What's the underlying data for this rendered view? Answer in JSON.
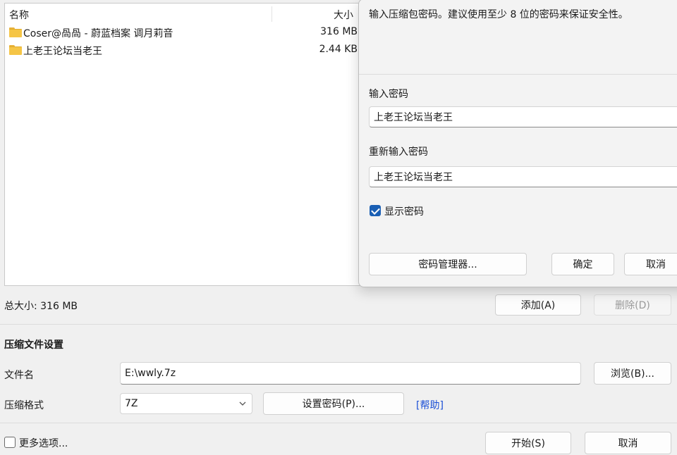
{
  "file_list": {
    "columns": {
      "name": "名称",
      "size": "大小"
    },
    "rows": [
      {
        "name": "Coser@咼咼 - 蔚蓝档案 调月莉音",
        "size": "316 MB",
        "icon": "folder-icon"
      },
      {
        "name": "上老王论坛当老王",
        "size": "2.44 KB",
        "icon": "folder-icon"
      }
    ]
  },
  "total_size": "总大小: 316 MB",
  "buttons": {
    "add": "添加(A)",
    "remove": "删除(D)",
    "browse": "浏览(B)...",
    "set_password": "设置密码(P)...",
    "start": "开始(S)",
    "cancel": "取消"
  },
  "settings": {
    "section_title": "压缩文件设置",
    "filename_label": "文件名",
    "filename_value": "E:\\wwly.7z",
    "format_label": "压缩格式",
    "format_value": "7Z",
    "help_link": "[帮助]",
    "more_options": "更多选项..."
  },
  "dialog": {
    "instruction": "输入压缩包密码。建议使用至少 8 位的密码来保证安全性。",
    "password_label": "输入密码",
    "password_value": "上老王论坛当老王",
    "reenter_label": "重新输入密码",
    "reenter_value": "上老王论坛当老王",
    "show_password_label": "显示密码",
    "show_password_checked": true,
    "manager_button": "密码管理器...",
    "ok_button": "确定",
    "cancel_button": "取消"
  },
  "colors": {
    "accent": "#1a5fb4",
    "link": "#1a4fd6",
    "folder": "#f5c546"
  }
}
